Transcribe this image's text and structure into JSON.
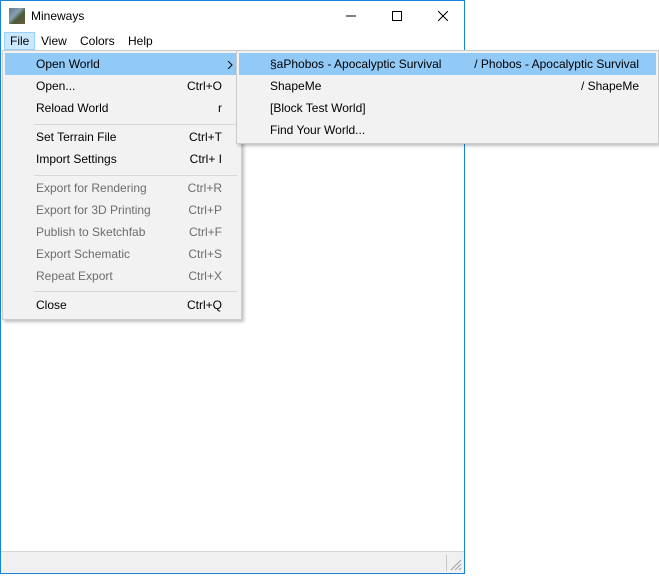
{
  "window": {
    "title": "Mineways"
  },
  "menubar": {
    "items": [
      "File",
      "View",
      "Colors",
      "Help"
    ]
  },
  "file_menu": {
    "items": [
      {
        "label": "Open World",
        "shortcut": "",
        "submenu": true,
        "disabled": false
      },
      {
        "label": "Open...",
        "shortcut": "Ctrl+O",
        "disabled": false
      },
      {
        "label": "Reload World",
        "shortcut": "r",
        "disabled": false
      },
      {
        "label": "Set Terrain File",
        "shortcut": "Ctrl+T",
        "disabled": false
      },
      {
        "label": "Import Settings",
        "shortcut": "Ctrl+ I",
        "disabled": false
      },
      {
        "label": "Export for Rendering",
        "shortcut": "Ctrl+R",
        "disabled": true
      },
      {
        "label": "Export for 3D Printing",
        "shortcut": "Ctrl+P",
        "disabled": true
      },
      {
        "label": "Publish to Sketchfab",
        "shortcut": "Ctrl+F",
        "disabled": true
      },
      {
        "label": "Export Schematic",
        "shortcut": "Ctrl+S",
        "disabled": true
      },
      {
        "label": "Repeat Export",
        "shortcut": "Ctrl+X",
        "disabled": true
      },
      {
        "label": "Close",
        "shortcut": "Ctrl+Q",
        "disabled": false
      }
    ]
  },
  "open_world_submenu": {
    "items": [
      {
        "label": "§aPhobos - Apocalyptic Survival",
        "folder": "/ Phobos - Apocalyptic Survival"
      },
      {
        "label": "ShapeMe",
        "folder": "/ ShapeMe"
      },
      {
        "label": "[Block Test World]",
        "folder": ""
      },
      {
        "label": "Find Your World...",
        "folder": ""
      }
    ]
  }
}
